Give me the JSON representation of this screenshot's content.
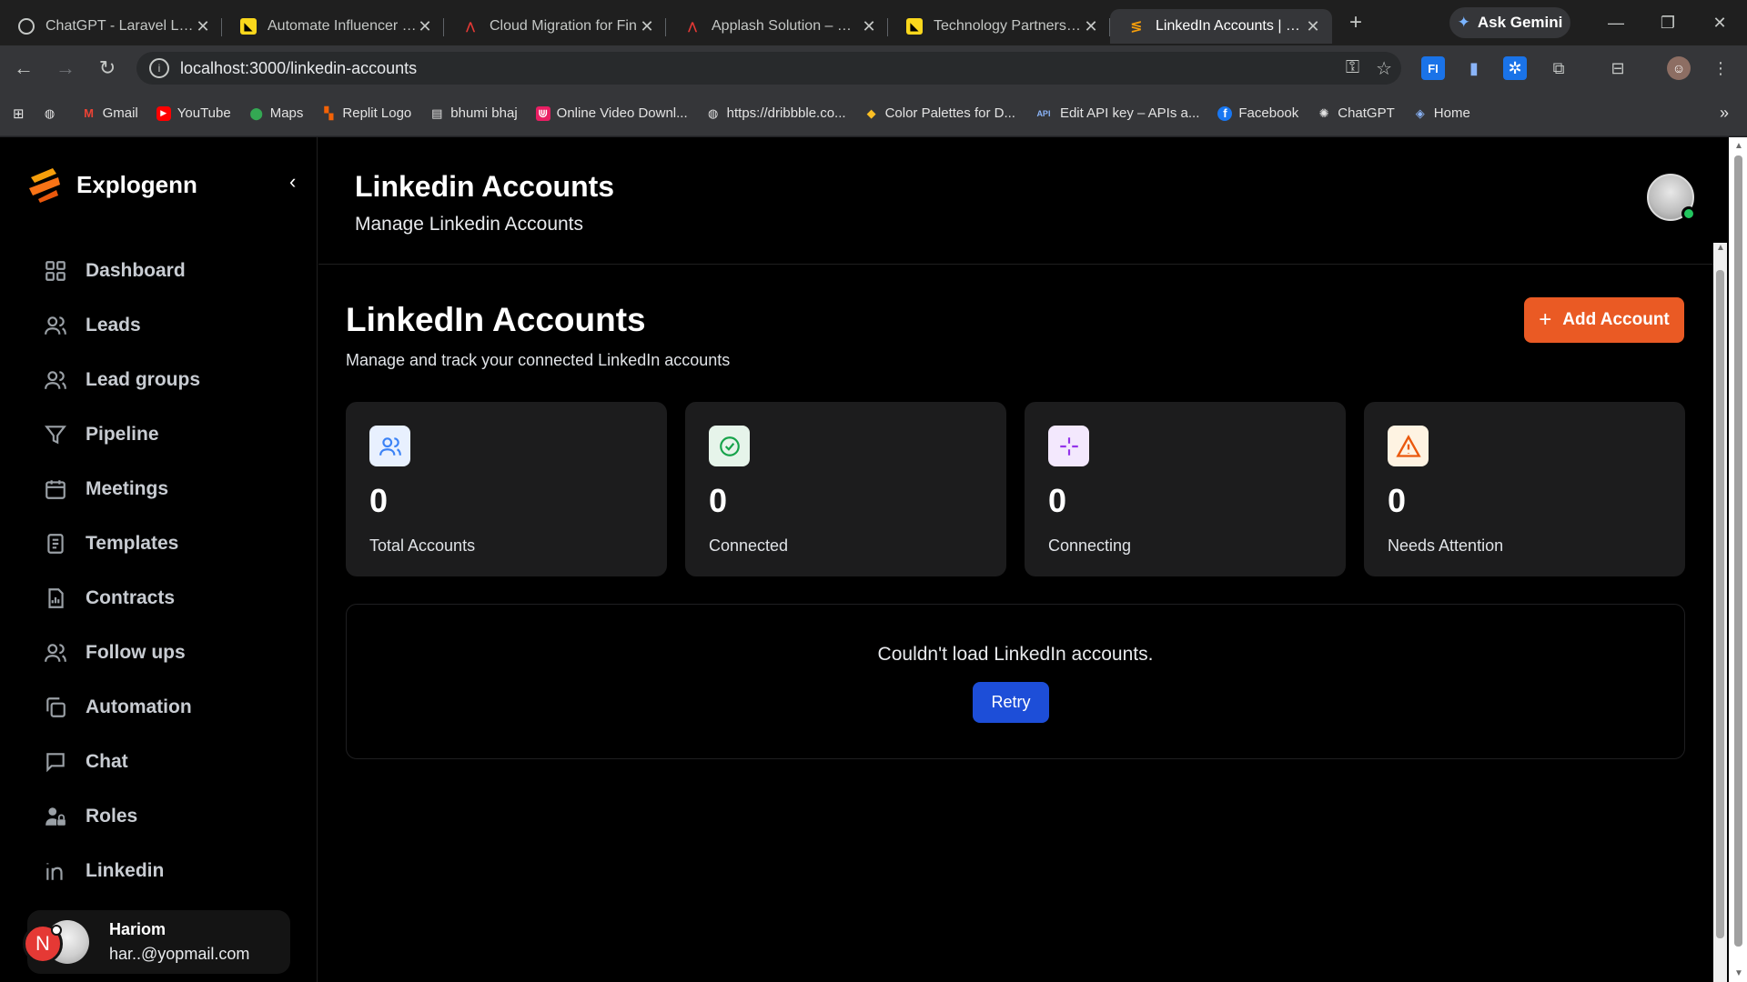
{
  "browser": {
    "tabs": [
      {
        "title": "ChatGPT - Laravel Learn",
        "icon": "chatgpt-icon",
        "active": false
      },
      {
        "title": "Automate Influencer Ma",
        "icon": "flag-icon",
        "active": false
      },
      {
        "title": "Cloud Migration for Fin",
        "icon": "applash-icon",
        "active": false
      },
      {
        "title": "Applash Solution – Mob",
        "icon": "applash-icon",
        "active": false
      },
      {
        "title": "Technology Partners for",
        "icon": "flag-icon",
        "active": false
      },
      {
        "title": "LinkedIn Accounts | Exp",
        "icon": "explogenn-icon",
        "active": true
      }
    ],
    "new_tab": "+",
    "ask_gemini": "Ask Gemini",
    "url": "localhost:3000/linkedin-accounts",
    "bookmarks": [
      {
        "label": "",
        "icon": "globe-icon"
      },
      {
        "label": "Gmail",
        "icon": "gmail-icon"
      },
      {
        "label": "YouTube",
        "icon": "youtube-icon"
      },
      {
        "label": "Maps",
        "icon": "maps-icon"
      },
      {
        "label": "Replit Logo",
        "icon": "replit-icon"
      },
      {
        "label": "bhumi bhaj",
        "icon": "doc-icon"
      },
      {
        "label": "Online Video Downl...",
        "icon": "video-icon"
      },
      {
        "label": "https://dribbble.co...",
        "icon": "globe-icon"
      },
      {
        "label": "Color Palettes for D...",
        "icon": "palette-icon"
      },
      {
        "label": "Edit API key – APIs a...",
        "icon": "api-icon"
      },
      {
        "label": "Facebook",
        "icon": "facebook-icon"
      },
      {
        "label": "ChatGPT",
        "icon": "chatgpt-icon"
      },
      {
        "label": "Home",
        "icon": "home-icon"
      }
    ]
  },
  "sidebar": {
    "brand": "Explogenn",
    "items": [
      {
        "label": "Dashboard",
        "icon": "grid-icon"
      },
      {
        "label": "Leads",
        "icon": "users-icon"
      },
      {
        "label": "Lead groups",
        "icon": "users-icon"
      },
      {
        "label": "Pipeline",
        "icon": "filter-icon"
      },
      {
        "label": "Meetings",
        "icon": "calendar-icon"
      },
      {
        "label": "Templates",
        "icon": "file-text-icon"
      },
      {
        "label": "Contracts",
        "icon": "file-chart-icon"
      },
      {
        "label": "Follow ups",
        "icon": "users-icon"
      },
      {
        "label": "Automation",
        "icon": "copy-icon"
      },
      {
        "label": "Chat",
        "icon": "chat-icon"
      },
      {
        "label": "Roles",
        "icon": "user-lock-icon"
      },
      {
        "label": "Linkedin",
        "icon": "linkedin-icon"
      }
    ],
    "user": {
      "name": "Hariom",
      "email": "har..@yopmail.com",
      "badge": "N"
    }
  },
  "header": {
    "title": "Linkedin Accounts",
    "subtitle": "Manage Linkedin Accounts"
  },
  "main": {
    "title": "LinkedIn Accounts",
    "subtitle": "Manage and track your connected LinkedIn accounts",
    "add_button": "Add Account",
    "stats": [
      {
        "value": "0",
        "label": "Total Accounts",
        "icon": "users-icon",
        "color": "#3b82f6",
        "bg": "#e8f0fe"
      },
      {
        "value": "0",
        "label": "Connected",
        "icon": "check-circle-icon",
        "color": "#16a34a",
        "bg": "#e6f4ea"
      },
      {
        "value": "0",
        "label": "Connecting",
        "icon": "sparkle-icon",
        "color": "#9333ea",
        "bg": "#f3e8fd"
      },
      {
        "value": "0",
        "label": "Needs Attention",
        "icon": "warning-icon",
        "color": "#ea580c",
        "bg": "#fef3e2"
      }
    ],
    "error_message": "Couldn't load LinkedIn accounts.",
    "retry_button": "Retry"
  },
  "colors": {
    "accent": "#ea5a24",
    "retry": "#1d4ed8",
    "online": "#22c55e"
  }
}
